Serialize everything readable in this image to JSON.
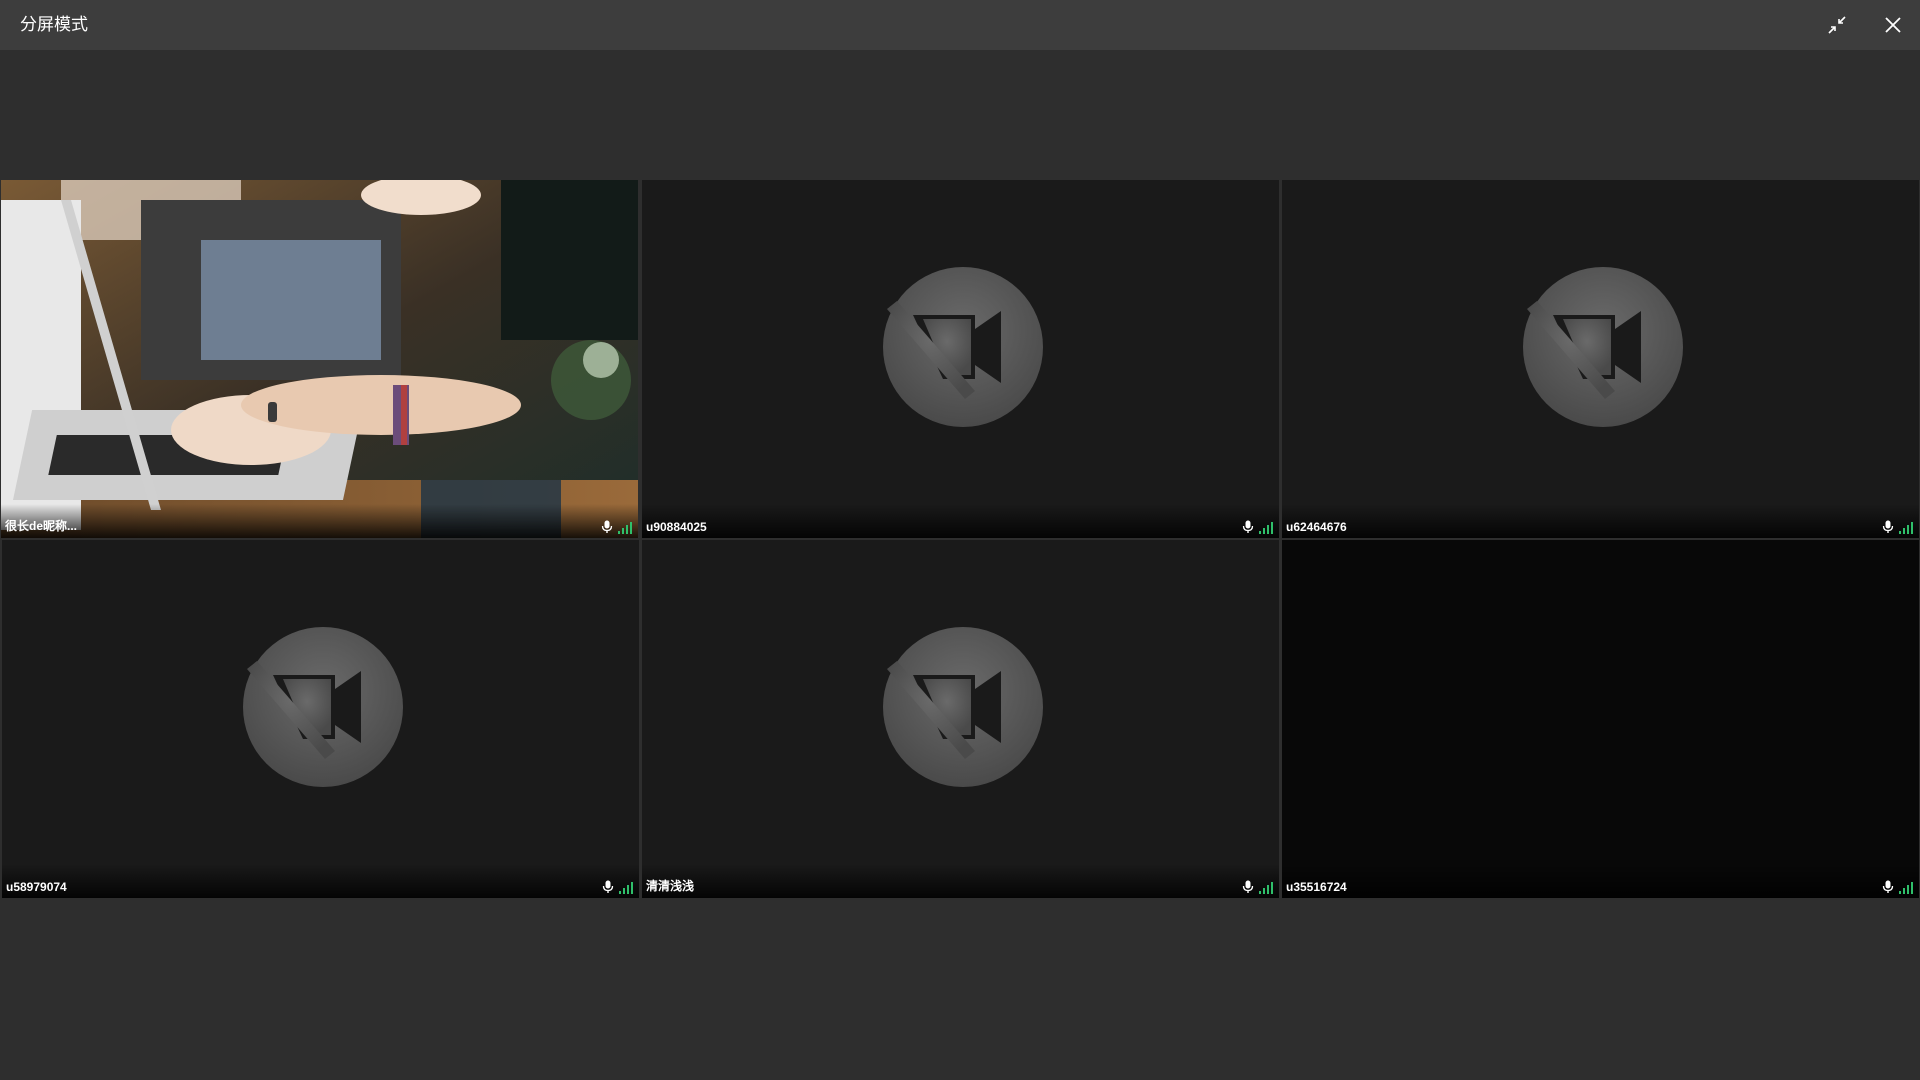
{
  "window": {
    "title": "分屏模式",
    "collapse_icon": "collapse-arrows-icon",
    "close_icon": "close-icon"
  },
  "participants": [
    {
      "name": "很长de昵称...",
      "video": "on",
      "mic_icon": "mic-icon",
      "signal_icon": "signal-strength-icon"
    },
    {
      "name": "u90884025",
      "video": "off",
      "mic_icon": "mic-icon",
      "signal_icon": "signal-strength-icon"
    },
    {
      "name": "u62464676",
      "video": "off",
      "mic_icon": "mic-icon",
      "signal_icon": "signal-strength-icon"
    },
    {
      "name": "u58979074",
      "video": "off",
      "mic_icon": "mic-icon",
      "signal_icon": "signal-strength-icon"
    },
    {
      "name": "清清浅浅",
      "video": "off",
      "mic_icon": "mic-icon",
      "signal_icon": "signal-strength-icon"
    },
    {
      "name": "u35516724",
      "video": "blank",
      "mic_icon": "mic-icon",
      "signal_icon": "signal-strength-icon"
    }
  ],
  "colors": {
    "background": "#2e2e2e",
    "titlebar": "#3d3d3d",
    "tile": "#1a1a1a",
    "signal": "#2fbf6a"
  }
}
